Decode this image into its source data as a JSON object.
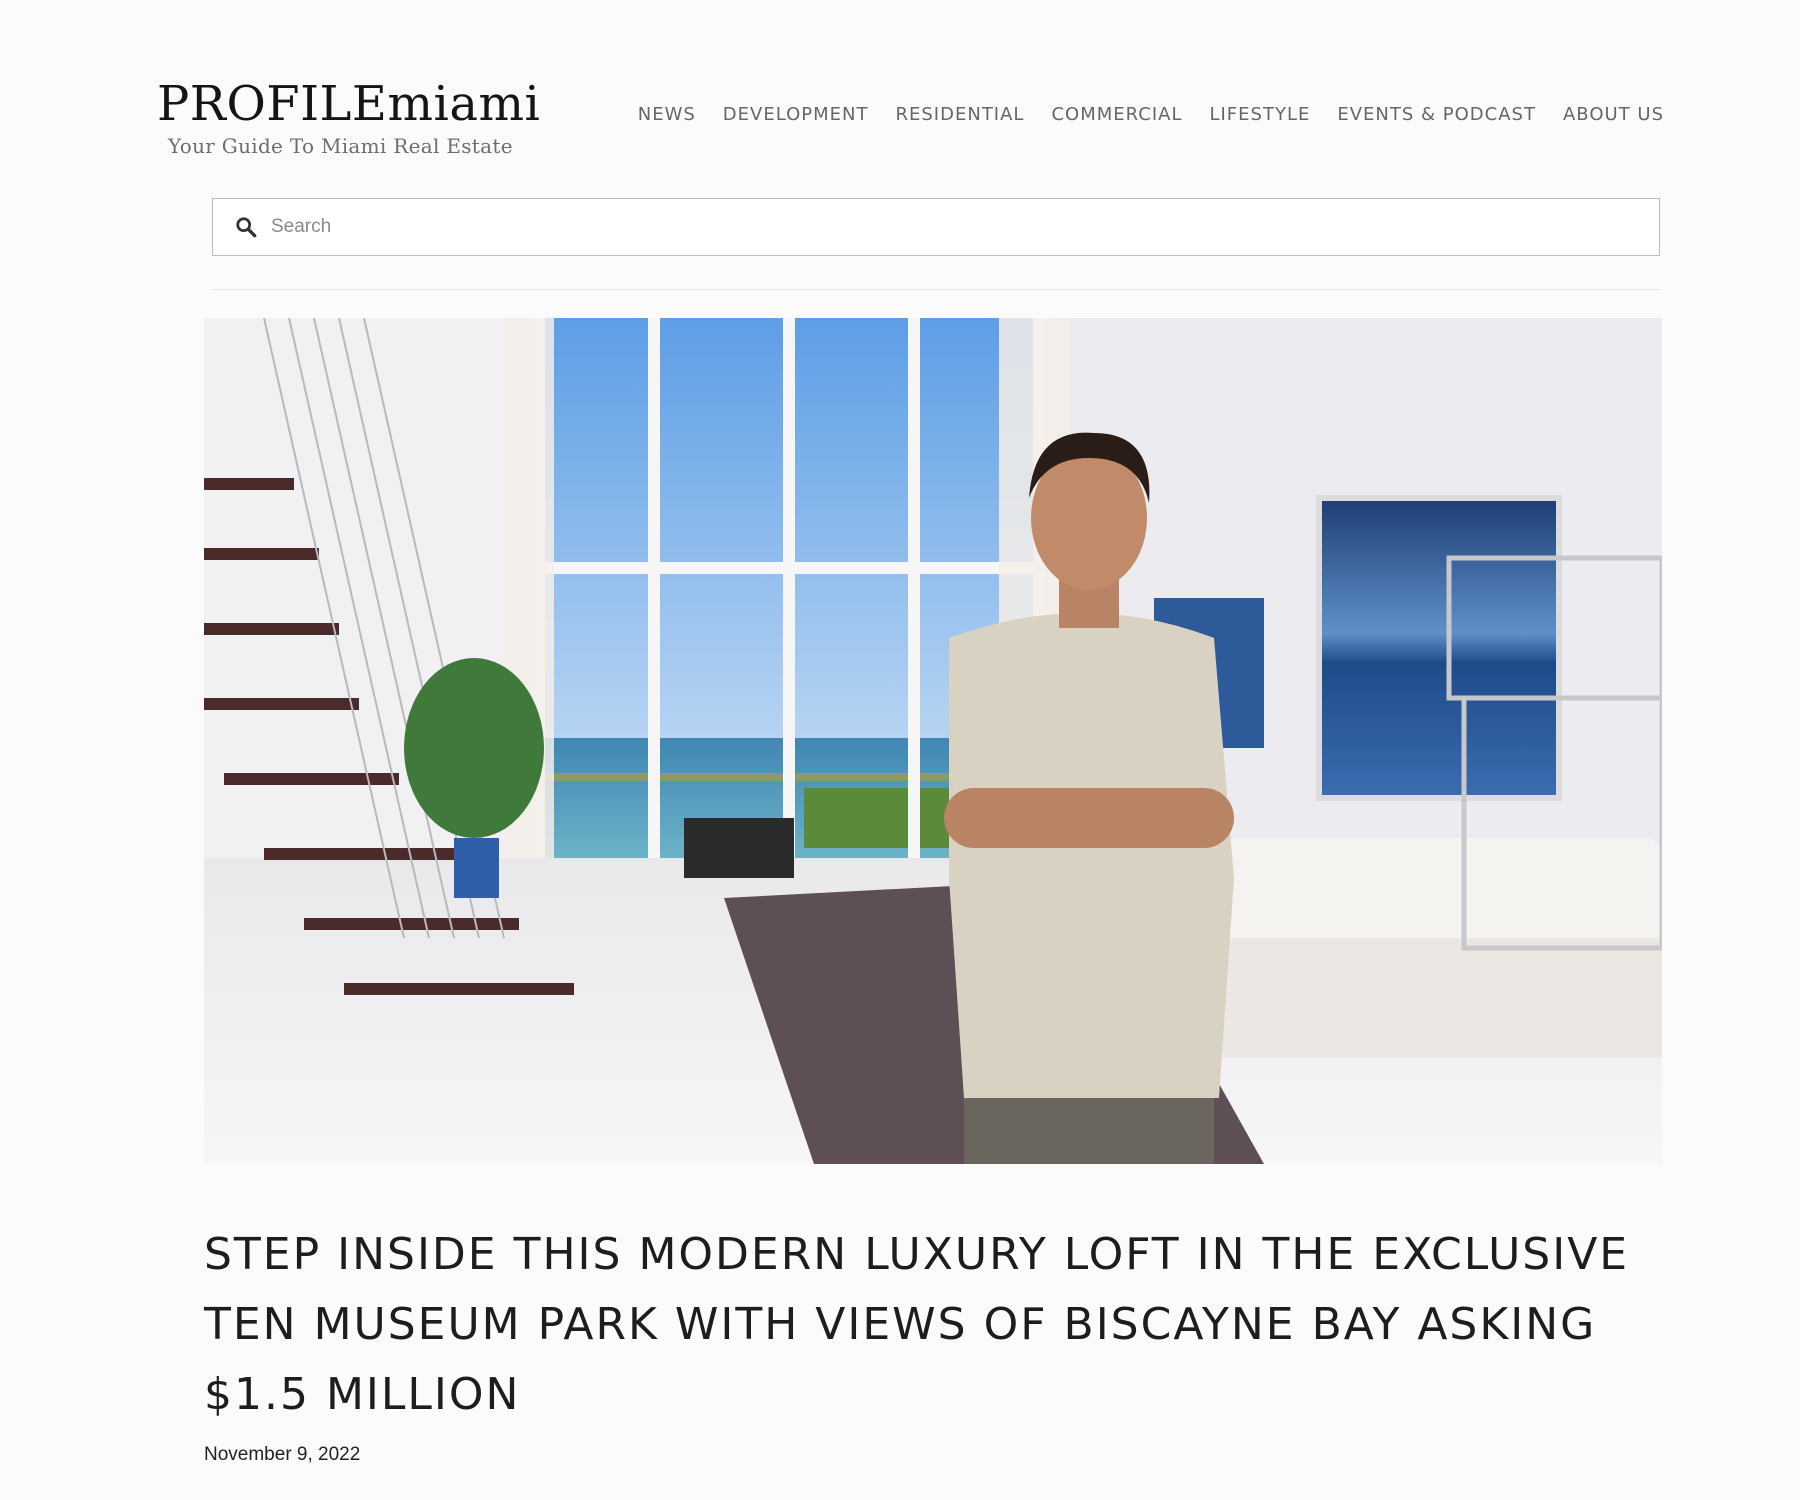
{
  "site": {
    "logo": "PROFILEmiami",
    "tagline": "Your Guide To Miami Real Estate"
  },
  "nav": {
    "items": [
      {
        "label": "NEWS"
      },
      {
        "label": "DEVELOPMENT"
      },
      {
        "label": "RESIDENTIAL"
      },
      {
        "label": "COMMERCIAL"
      },
      {
        "label": "LIFESTYLE"
      },
      {
        "label": "EVENTS & PODCAST"
      },
      {
        "label": "ABOUT US"
      }
    ]
  },
  "search": {
    "placeholder": "Search",
    "value": "",
    "icon": "search-icon"
  },
  "article": {
    "hero_image": "photo of modern luxury loft interior with man standing in living room",
    "headline": "STEP INSIDE THIS MODERN LUXURY LOFT IN THE EXCLUSIVE TEN MUSEUM PARK WITH VIEWS OF BISCAYNE BAY ASKING $1.5 MILLION",
    "date": "November 9, 2022"
  },
  "colors": {
    "background": "#fbfbfb",
    "nav_text": "#666666",
    "headline_text": "#1d1d1d"
  }
}
